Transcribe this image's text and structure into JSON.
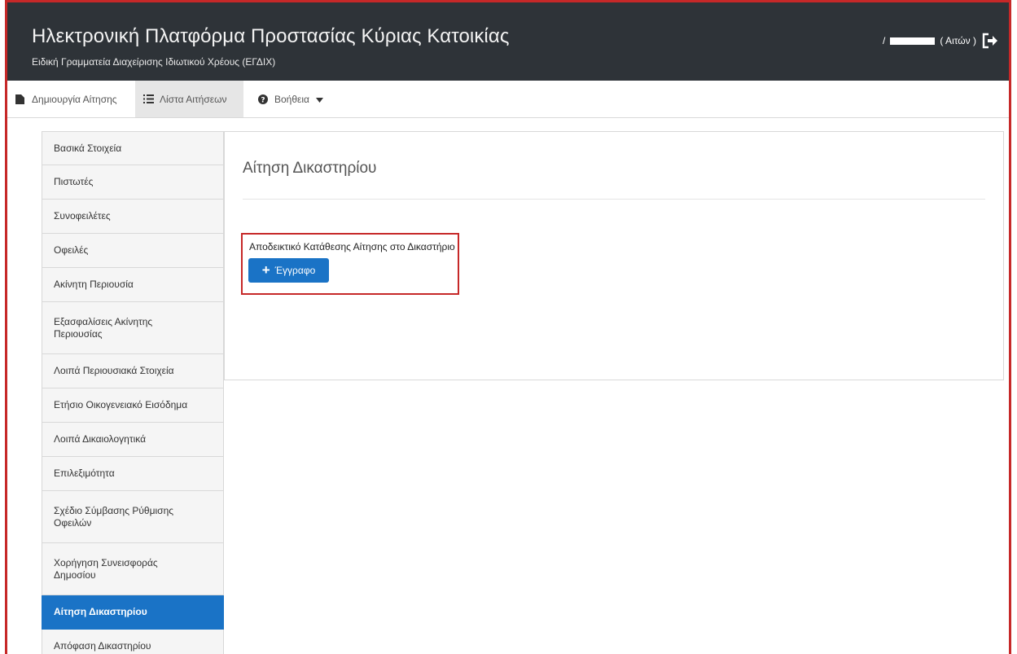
{
  "header": {
    "title": "Ηλεκτρονική Πλατφόρμα Προστασίας Κύριας Κατοικίας",
    "subtitle": "Ειδική Γραμματεία Διαχείρισης Ιδιωτικού Χρέους (ΕΓΔΙΧ)",
    "user_prefix": "/ ",
    "user_suffix": "( Αιτών )"
  },
  "menu": {
    "create": "Δημιουργία Αίτησης",
    "list": "Λίστα Αιτήσεων",
    "help": "Βοήθεια"
  },
  "sidebar": {
    "items": [
      {
        "label": "Βασικά Στοιχεία"
      },
      {
        "label": "Πιστωτές"
      },
      {
        "label": "Συνοφειλέτες"
      },
      {
        "label": "Οφειλές"
      },
      {
        "label": "Ακίνητη Περιουσία"
      },
      {
        "label": "Εξασφαλίσεις Ακίνητης Περιουσίας"
      },
      {
        "label": "Λοιπά Περιουσιακά Στοιχεία"
      },
      {
        "label": "Ετήσιο Οικογενειακό Εισόδημα"
      },
      {
        "label": "Λοιπά Δικαιολογητικά"
      },
      {
        "label": "Επιλεξιμότητα"
      },
      {
        "label": "Σχέδιο Σύμβασης Ρύθμισης Οφειλών"
      },
      {
        "label": "Χορήγηση Συνεισφοράς Δημοσίου"
      },
      {
        "label": "Αίτηση Δικαστηρίου"
      },
      {
        "label": "Απόφαση Δικαστηρίου"
      }
    ]
  },
  "panel": {
    "title": "Αίτηση Δικαστηρίου",
    "doc_label": "Αποδεικτικό Κατάθεσης Αίτησης στο Δικαστήριο",
    "doc_button": "Έγγραφο"
  },
  "colors": {
    "accent": "#1a73c6",
    "highlight": "#c62828",
    "topbar": "#2e3338"
  }
}
